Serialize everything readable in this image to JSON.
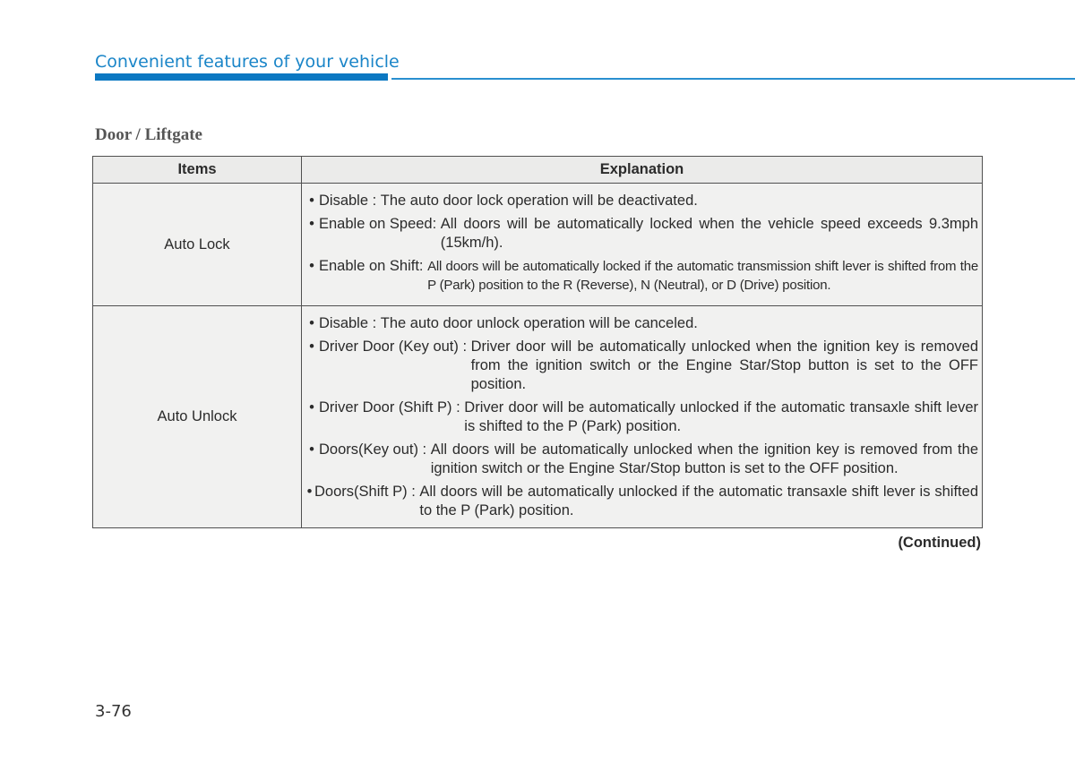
{
  "header": {
    "chapter_title": "Convenient features of your vehicle",
    "accent_color": "#0b78c2"
  },
  "section": {
    "title": "Door / Liftgate"
  },
  "table": {
    "columns": [
      "Items",
      "Explanation"
    ],
    "rows": [
      {
        "item": "Auto Lock",
        "bullets": [
          {
            "label": "Disable : ",
            "text": "The auto door lock operation will be deactivated."
          },
          {
            "label": "Enable on Speed: ",
            "text": "All doors will be automatically locked when the vehicle speed exceeds 9.3mph (15km/h)."
          },
          {
            "label": "Enable on Shift: ",
            "text": "All doors will be automatically locked if the automatic transmission shift lever is shifted from the P (Park) position to the R (Reverse), N (Neutral), or D (Drive) position."
          }
        ]
      },
      {
        "item": "Auto Unlock",
        "bullets": [
          {
            "label": "Disable : ",
            "text": "The auto door unlock operation will be canceled."
          },
          {
            "label": "Driver Door (Key out) : ",
            "text": "Driver door will be automatically unlocked when the ignition key is removed from the ignition switch or the Engine Star/Stop button is set to the OFF position."
          },
          {
            "label": "Driver Door (Shift P) : ",
            "text": "Driver door will be automatically unlocked if the automatic transaxle shift lever is shifted to the P (Park) position."
          },
          {
            "label": "Doors(Key out) : ",
            "text": "All doors will be automatically unlocked when the ignition key is removed from the ignition switch or the Engine Star/Stop button is set to the OFF position."
          },
          {
            "label": "Doors(Shift P) : ",
            "text": "All doors will be automatically unlocked if the automatic transaxle shift lever is shifted to the P (Park) position."
          }
        ]
      }
    ]
  },
  "footer": {
    "continued": "(Continued)",
    "page_number": "3-76"
  }
}
